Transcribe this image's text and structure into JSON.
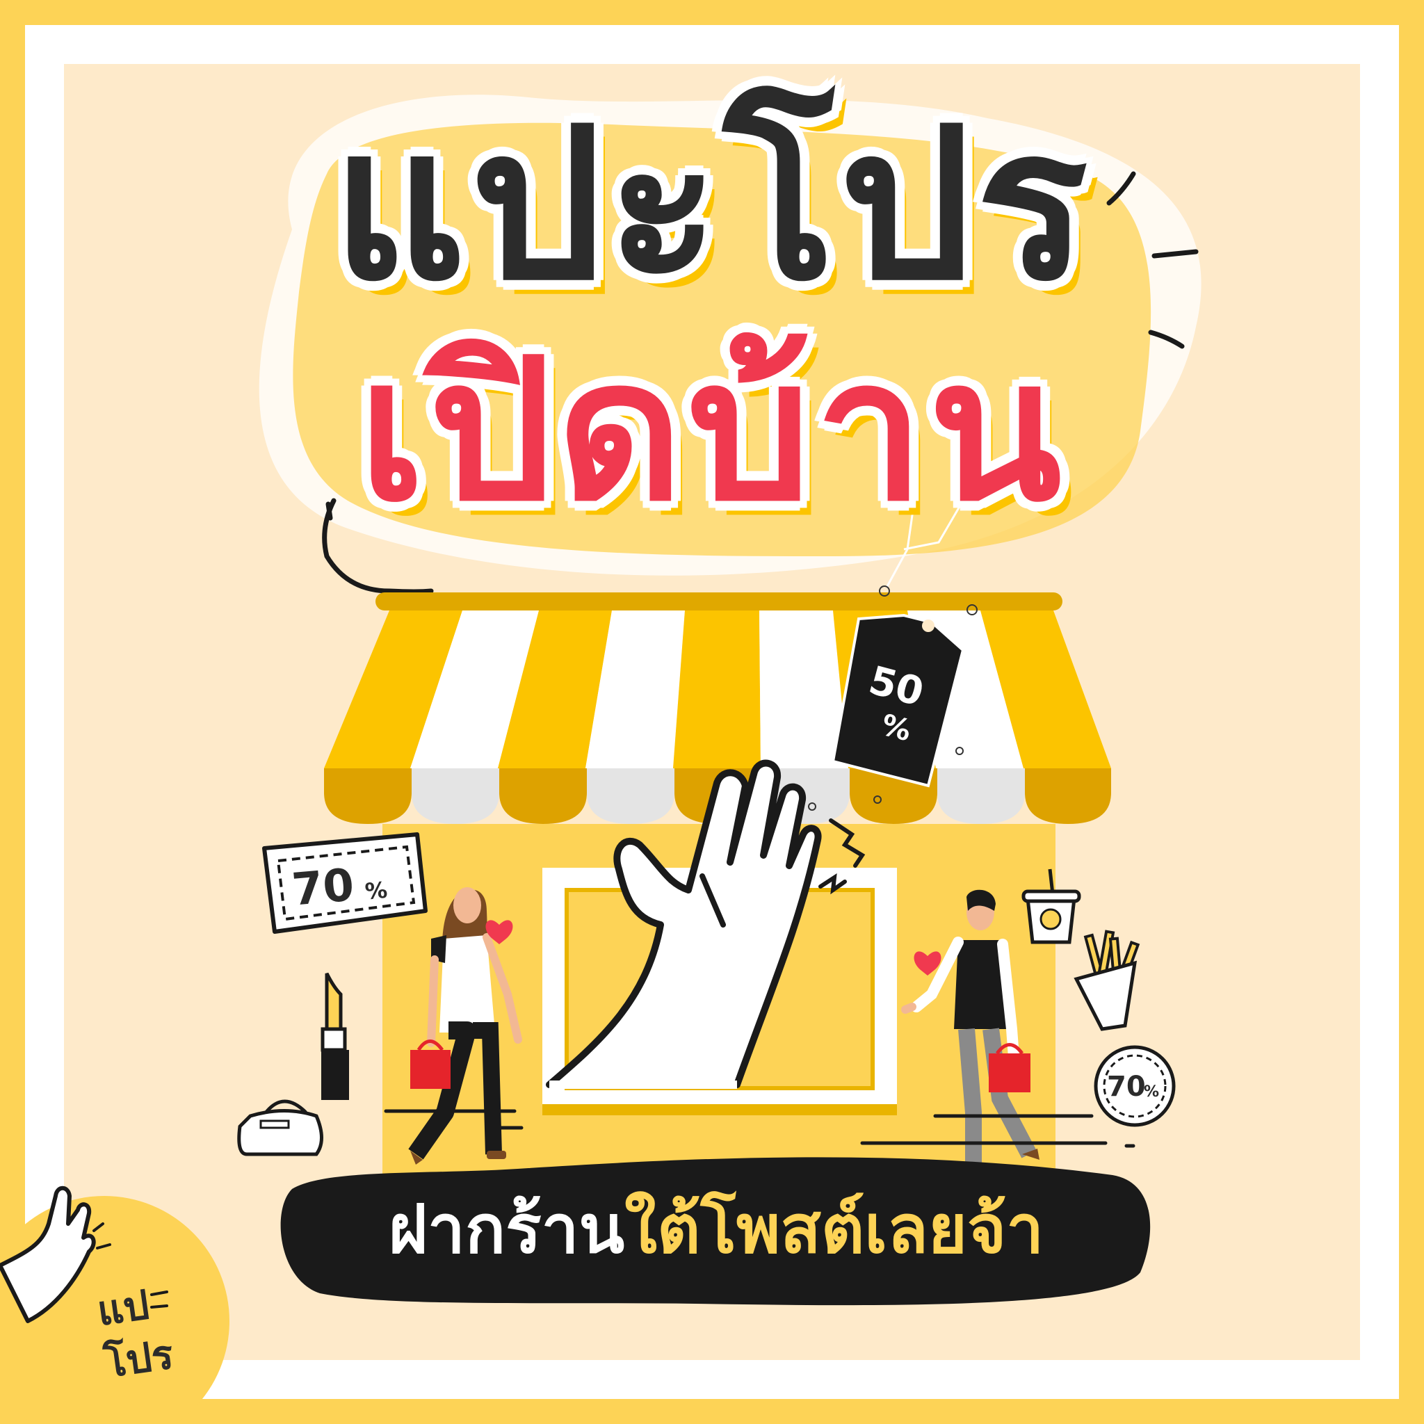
{
  "title": {
    "line1": "แปะโปร",
    "line2": "เปิดบ้าน"
  },
  "call_to_action": {
    "part1": "ฝากร้าน",
    "part2": "ใต้โพสต์เลยจ้า"
  },
  "price_tag": {
    "value": "50",
    "unit": "%"
  },
  "coupons": {
    "left_value": "70",
    "left_unit": "%",
    "right_value": "70",
    "right_unit": "%"
  },
  "logo": {
    "line1": "แป",
    "line2": "โปร"
  },
  "colors": {
    "frame": "#FDD356",
    "background": "#FEEACA",
    "awning_yellow": "#FCC400",
    "awning_dark": "#DDA200",
    "title_dark": "#2B2B2B",
    "title_red": "#F0394F",
    "cta_bar": "#1A1A1A",
    "bag_red": "#E5242B"
  },
  "icons": [
    "waving-hand-icon",
    "price-tag-icon",
    "coupon-icon",
    "lipstick-icon",
    "handbag-icon",
    "drink-cup-icon",
    "fries-icon",
    "heart-icon",
    "shopping-bag-icon"
  ]
}
